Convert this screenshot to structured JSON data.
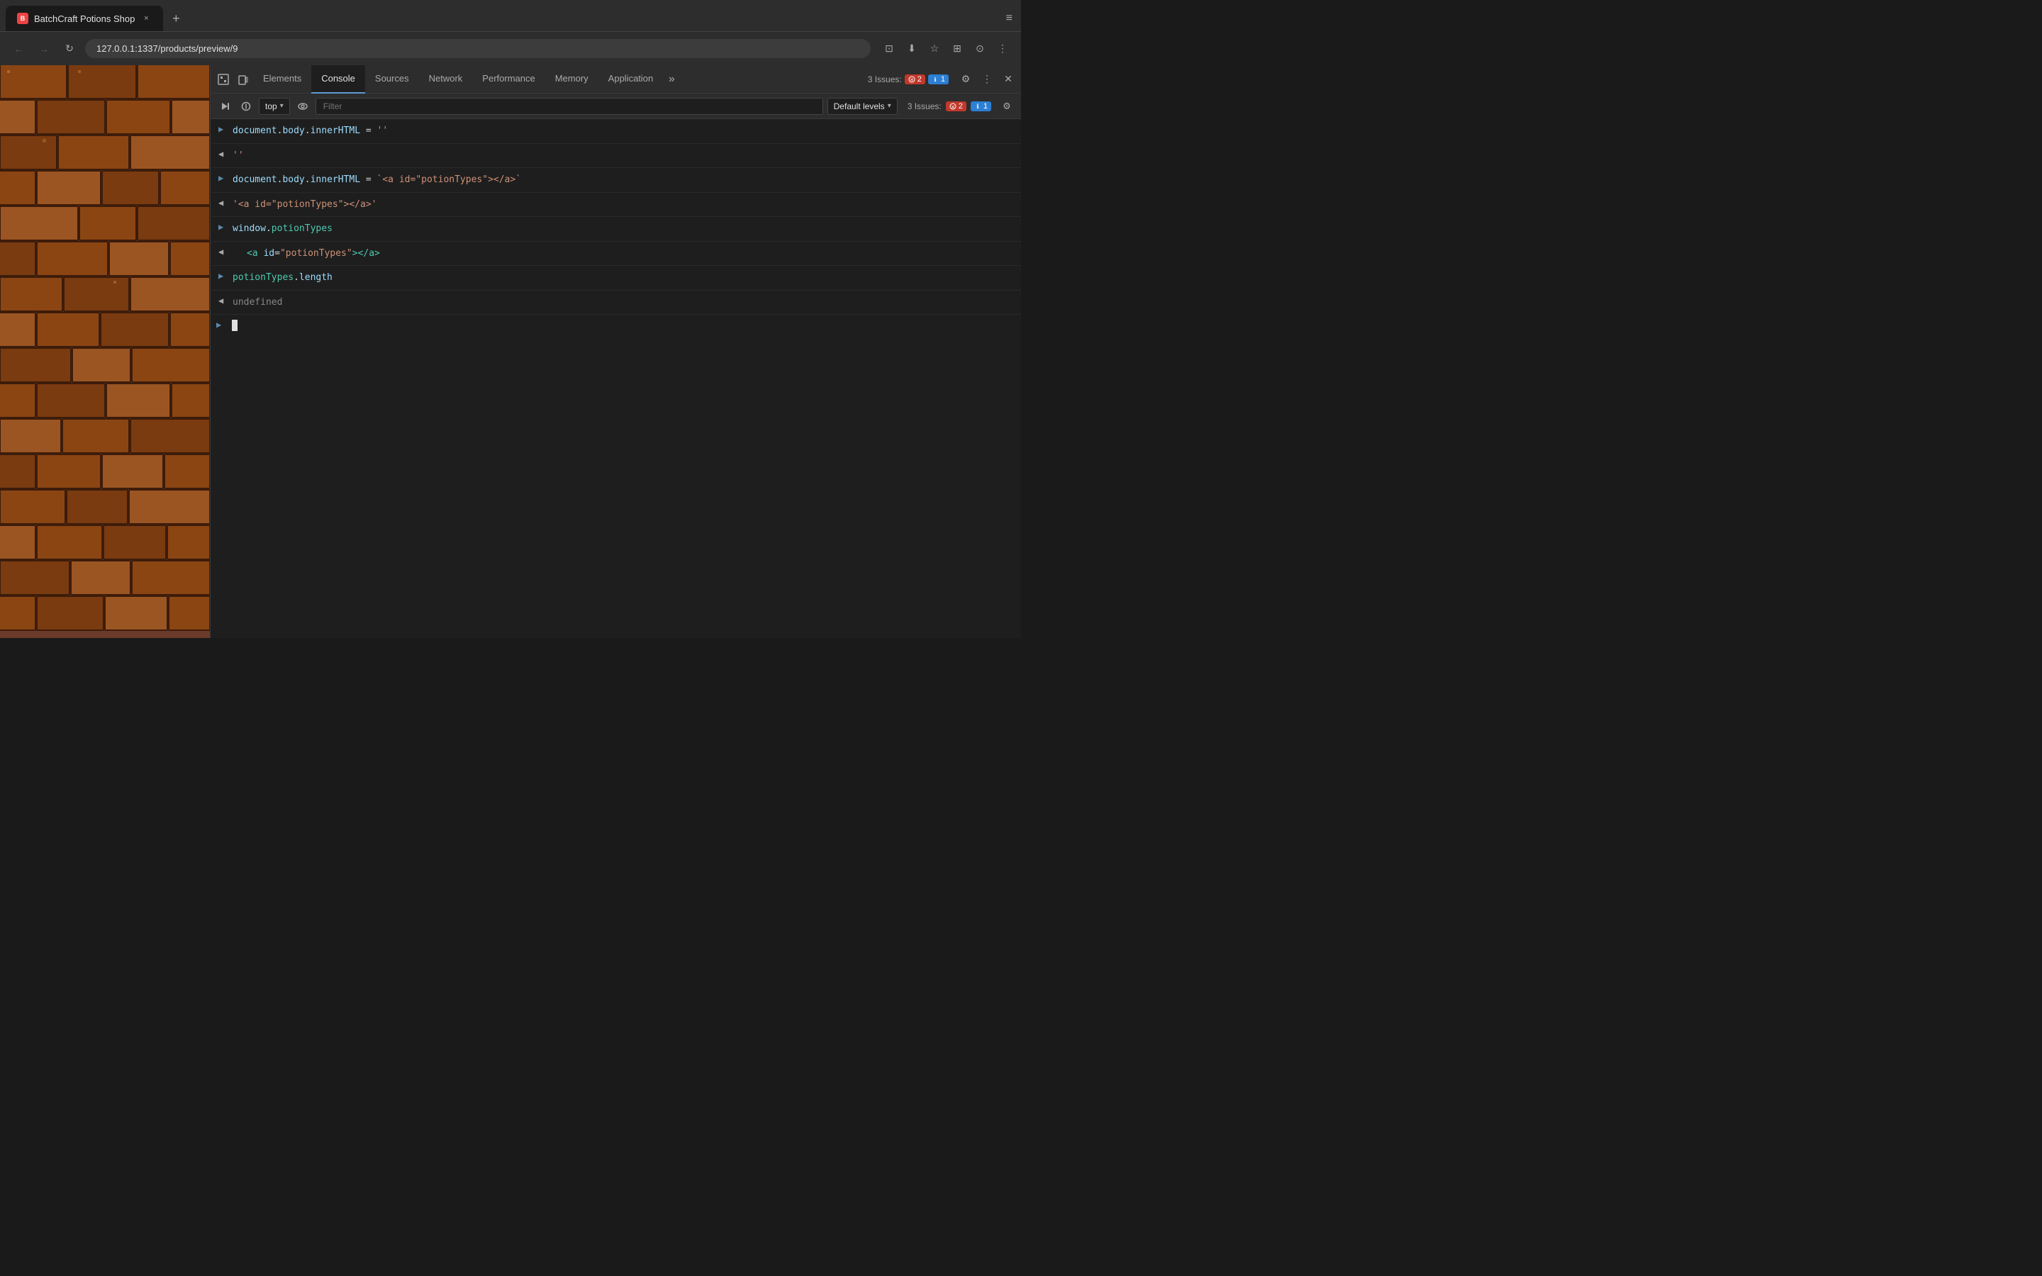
{
  "browser": {
    "tab": {
      "title": "BatchCraft Potions Shop",
      "favicon_label": "B",
      "close_label": "×"
    },
    "new_tab_label": "+",
    "address": "127.0.0.1:1337/products/preview/9",
    "overflow_label": "≡"
  },
  "nav_buttons": {
    "back": "←",
    "forward": "→",
    "refresh": "↻",
    "home": "⌂"
  },
  "toolbar_icons": {
    "cast": "⊡",
    "bookmark": "☆",
    "profile": "⊙",
    "menu": "⋮"
  },
  "devtools": {
    "inspector_icon": "⬚",
    "device_icon": "⬜",
    "tabs": [
      {
        "label": "Elements",
        "active": false
      },
      {
        "label": "Console",
        "active": true
      },
      {
        "label": "Sources",
        "active": false
      },
      {
        "label": "Network",
        "active": false
      },
      {
        "label": "Performance",
        "active": false
      },
      {
        "label": "Memory",
        "active": false
      },
      {
        "label": "Application",
        "active": false
      }
    ],
    "more_tabs_label": "»",
    "issues_label": "3 Issues:",
    "error_count": "2",
    "warning_count": "1",
    "settings_label": "⚙",
    "options_label": "⋮",
    "close_label": "✕"
  },
  "console": {
    "run_btn": "▶",
    "clear_btn": "⊘",
    "context": "top",
    "context_arrow": "▾",
    "eye_icon": "◉",
    "filter_placeholder": "Filter",
    "levels_label": "Default levels",
    "levels_arrow": "▾",
    "issues_text": "3 Issues:",
    "issues_error": "2",
    "issues_info": "1",
    "settings_icon": "⚙"
  },
  "console_entries": [
    {
      "type": "input",
      "arrow": "▶",
      "content_html": "document.body.innerHTML = ''"
    },
    {
      "type": "output",
      "arrow": "◀",
      "content_html": "''"
    },
    {
      "type": "input",
      "arrow": "▶",
      "content_html": "document.body.innerHTML = `<a id=\"potionTypes\"></a>`"
    },
    {
      "type": "output",
      "arrow": "◀",
      "content_html": "'<a id=\"potionTypes\"></a>'"
    },
    {
      "type": "input",
      "arrow": "▶",
      "content_html": "window.potionTypes"
    },
    {
      "type": "output",
      "arrow": "◀",
      "content_html": "<a id=\"potionTypes\"></a>"
    },
    {
      "type": "input",
      "arrow": "▶",
      "content_html": "potionTypes.length"
    },
    {
      "type": "output",
      "arrow": "◀",
      "content_html": "undefined"
    }
  ]
}
